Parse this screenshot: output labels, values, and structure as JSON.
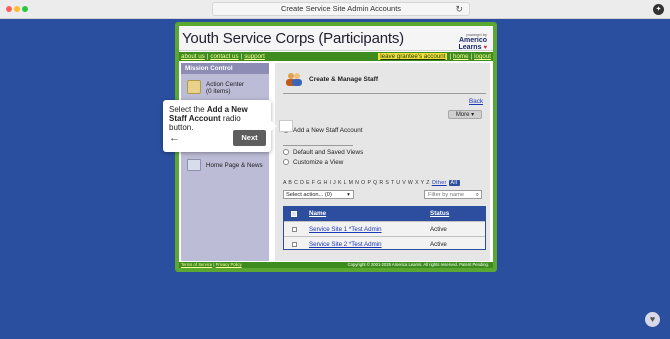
{
  "browser": {
    "url_title": "Create Service Site Admin Accounts"
  },
  "header": {
    "title": "Youth Service Corps (Participants)",
    "powered_by": "powered by",
    "brand_line1": "Americo",
    "brand_line2": "Learns"
  },
  "nav": {
    "about": "about us",
    "contact": "contact us",
    "support": "support",
    "leave": "leave grantee's account",
    "home": "home",
    "logout": "logout"
  },
  "sidebar": {
    "heading": "Mission Control",
    "action_center": "Action Center",
    "action_count": "(0 items)",
    "home_news": "Home Page & News"
  },
  "main": {
    "title": "Create & Manage Staff",
    "back": "Back",
    "more": "More",
    "radio_add": "Add a New Staff Account",
    "radio_default": "Default and Saved Views",
    "radio_customize": "Customize a View",
    "letters": "A B C D E F G H I J K L M N O P Q R S T U V W X Y Z",
    "other": "Other",
    "all": "All",
    "select_action": "Select action... (0)",
    "filter_placeholder": "Filter by name",
    "table": {
      "col_name": "Name",
      "col_status": "Status",
      "rows": [
        {
          "name": "Service Site 1 *Test Admin",
          "status": "Active"
        },
        {
          "name": "Service Site 2 *Test Admin",
          "status": "Active"
        }
      ]
    }
  },
  "footer": {
    "terms": "Terms of Service",
    "privacy": "Privacy Policy",
    "copyright": "Copyright © 2001-2025 America Learns. All rights reserved. Patent Pending."
  },
  "tooltip": {
    "pre": "Select the ",
    "bold": "Add a New Staff Account",
    "post": " radio button.",
    "next": "Next"
  }
}
